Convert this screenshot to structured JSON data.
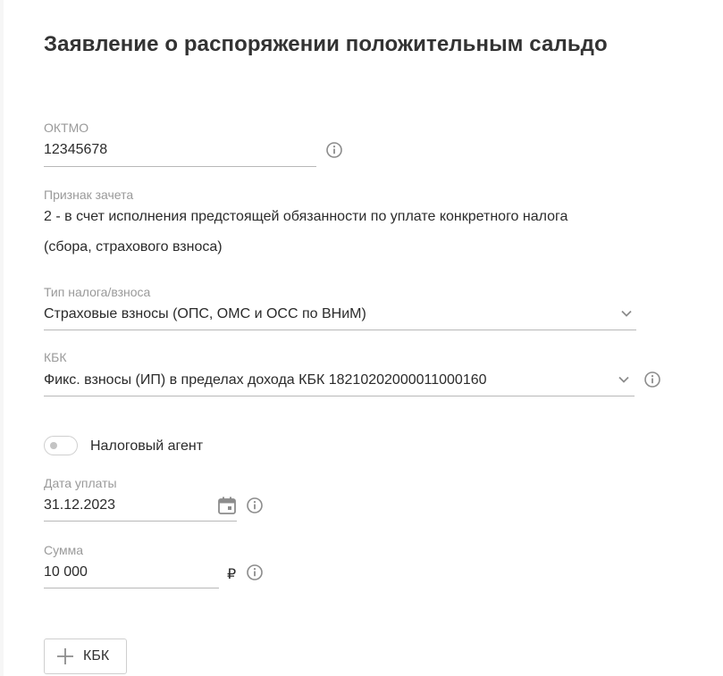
{
  "form": {
    "title": "Заявление о распоряжении положительным сальдо",
    "oktmo": {
      "label": "ОКТМО",
      "value": "12345678"
    },
    "offset_sign": {
      "label": "Признак зачета",
      "value_line1": "2 - в счет исполнения предстоящей обязанности по уплате конкретного налога",
      "value_line2": "(сбора, страхового взноса)"
    },
    "tax_type": {
      "label": "Тип налога/взноса",
      "value": "Страховые взносы (ОПС, ОМС и ОСС по ВНиМ)"
    },
    "kbk": {
      "label": "КБК",
      "value": "Фикс. взносы (ИП) в пределах дохода КБК 18210202000011000160"
    },
    "tax_agent": {
      "label": "Налоговый агент",
      "enabled": false
    },
    "payment_date": {
      "label": "Дата уплаты",
      "value": "31.12.2023"
    },
    "amount": {
      "label": "Сумма",
      "value": "10 000",
      "currency": "₽"
    },
    "add_kbk_button": {
      "label": "КБК"
    }
  },
  "colors": {
    "text": "#2b2b2b",
    "label": "#9a9a9a",
    "icon": "#8c8c8c",
    "underline": "#b8b8b8"
  },
  "icons": {
    "info": "info-icon",
    "chevron": "chevron-down-icon",
    "calendar": "calendar-icon",
    "plus": "plus-icon"
  }
}
